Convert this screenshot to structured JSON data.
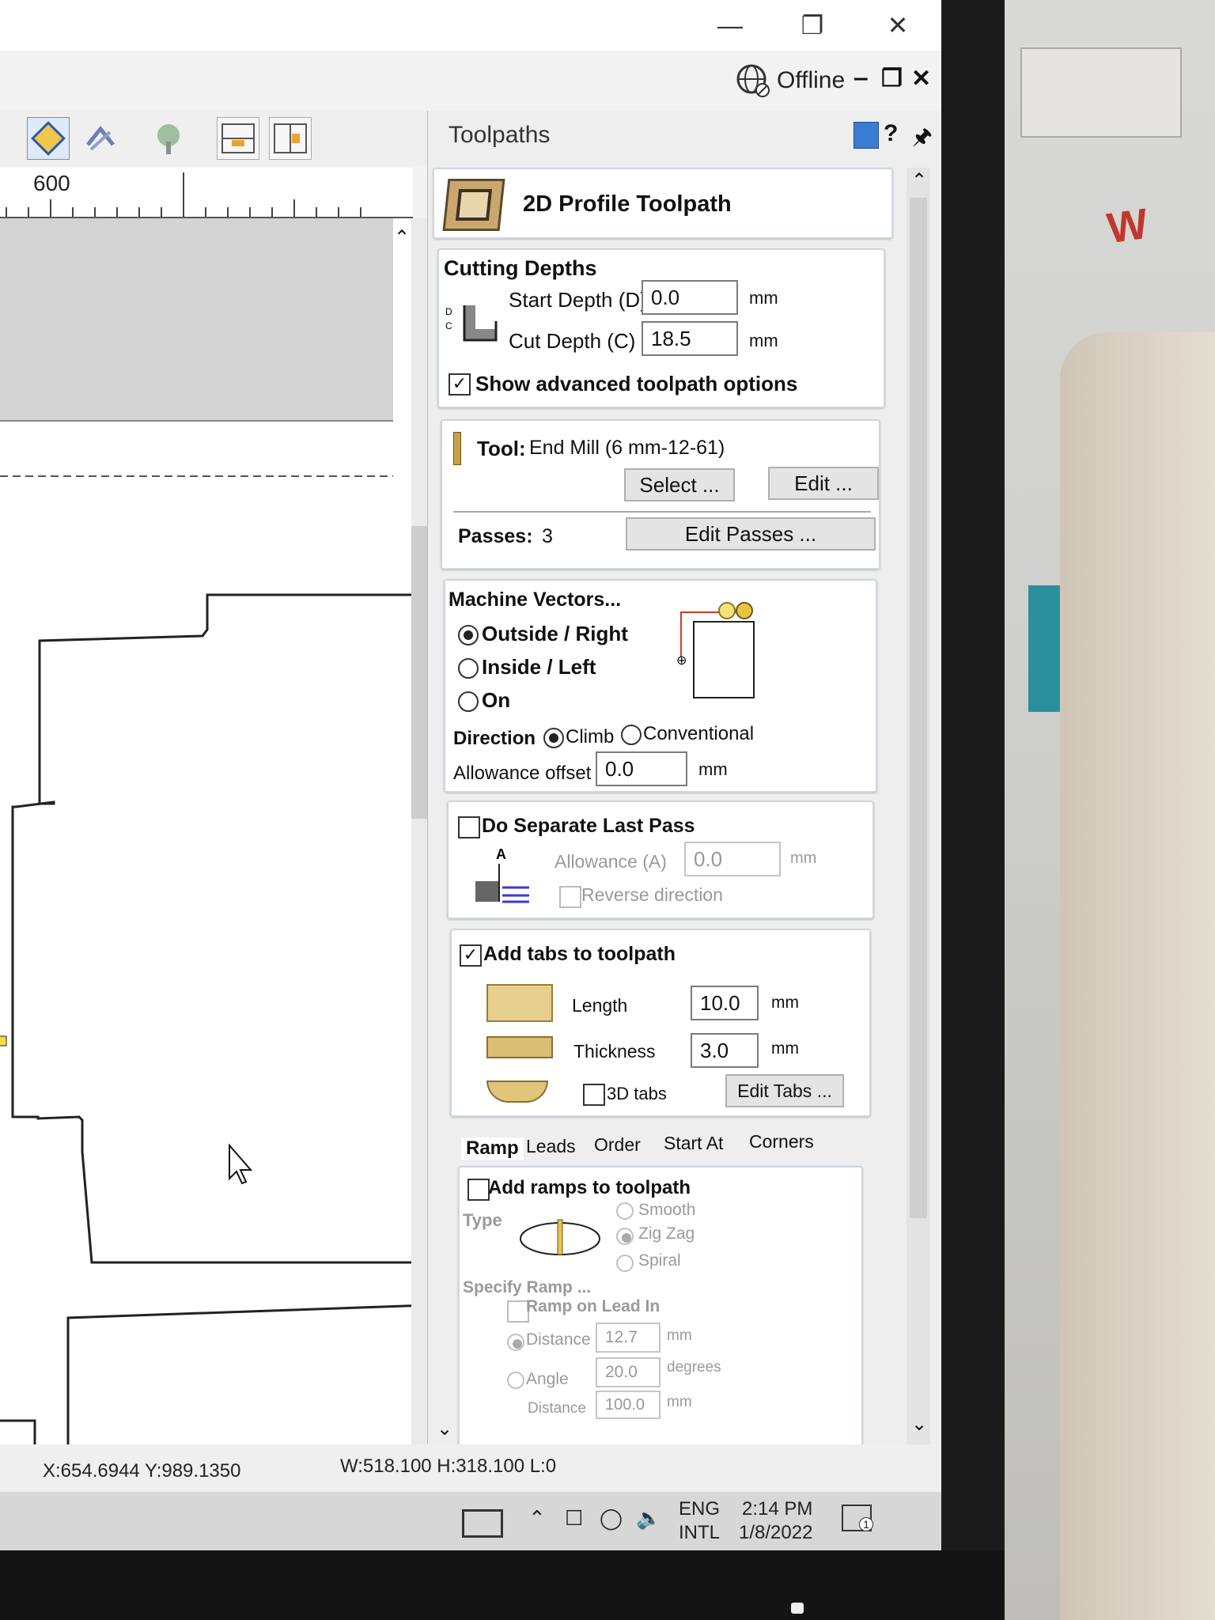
{
  "window": {
    "minimize_icon": "minimize-icon",
    "restore_icon": "restore-icon",
    "close_icon": "close-icon",
    "status": "Offline"
  },
  "ruler": {
    "label": "600"
  },
  "panel": {
    "title": "Toolpaths",
    "help_label": "?",
    "toolpath_title": "2D Profile Toolpath",
    "cutting_depths": {
      "heading": "Cutting Depths",
      "start_depth_label": "Start Depth (D)",
      "start_depth_value": "0.0",
      "cut_depth_label": "Cut Depth (C)",
      "cut_depth_value": "18.5",
      "unit": "mm",
      "show_advanced_label": "Show advanced toolpath options",
      "show_advanced_checked": true
    },
    "tool": {
      "label": "Tool:",
      "value": "End Mill (6 mm-12-61)",
      "select_button": "Select ...",
      "edit_button": "Edit ...",
      "passes_label": "Passes:",
      "passes_value": "3",
      "edit_passes_button": "Edit Passes ..."
    },
    "machine_vectors": {
      "heading": "Machine Vectors...",
      "options": [
        "Outside / Right",
        "Inside / Left",
        "On"
      ],
      "selected": "Outside / Right",
      "direction_label": "Direction",
      "climb_label": "Climb",
      "conventional_label": "Conventional",
      "direction_selected": "Climb",
      "allowance_label": "Allowance offset",
      "allowance_value": "0.0",
      "unit": "mm"
    },
    "last_pass": {
      "label": "Do Separate Last Pass",
      "checked": false,
      "allowance_label": "Allowance (A)",
      "allowance_value": "0.0",
      "unit": "mm",
      "reverse_label": "Reverse direction",
      "figure_letter": "A"
    },
    "tabs": {
      "label": "Add tabs to toolpath",
      "checked": true,
      "length_label": "Length",
      "length_value": "10.0",
      "thickness_label": "Thickness",
      "thickness_value": "3.0",
      "unit": "mm",
      "tabs3d_label": "3D tabs",
      "edit_tabs_button": "Edit Tabs ..."
    },
    "subtabs": [
      "Ramp",
      "Leads",
      "Order",
      "Start At",
      "Corners"
    ],
    "ramp": {
      "label": "Add ramps to toolpath",
      "type_label": "Type",
      "types": [
        "Smooth",
        "Zig Zag",
        "Spiral"
      ],
      "type_selected": "Zig Zag",
      "specify_label": "Specify Ramp ...",
      "lead_in_label": "Ramp on Lead In",
      "distance_label": "Distance",
      "distance_value": "12.7",
      "distance_unit": "mm",
      "angle_label": "Angle",
      "angle_value": "20.0",
      "angle_unit": "degrees",
      "distance2_label": "Distance",
      "distance2_value": "100.0",
      "distance2_unit": "mm"
    }
  },
  "status_bar": {
    "cursor": "X:654.6944 Y:989.1350",
    "dims": "W:518.100  H:318.100  L:0"
  },
  "taskbar": {
    "lang_top": "ENG",
    "lang_bottom": "INTL",
    "time": "2:14 PM",
    "date": "1/8/2022",
    "notification_count": "1"
  }
}
